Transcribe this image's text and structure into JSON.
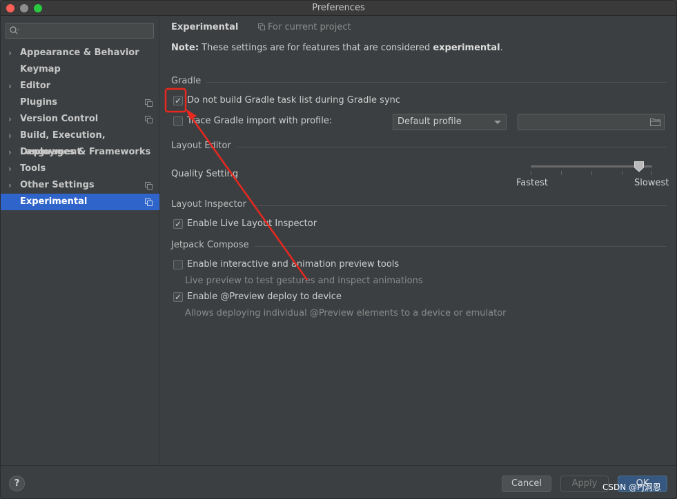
{
  "window": {
    "title": "Preferences"
  },
  "sidebar": {
    "search": {
      "placeholder": ""
    },
    "items": [
      {
        "label": "Appearance & Behavior",
        "expandable": true,
        "project_icon": false,
        "selected": false
      },
      {
        "label": "Keymap",
        "expandable": false,
        "project_icon": false,
        "selected": false
      },
      {
        "label": "Editor",
        "expandable": true,
        "project_icon": false,
        "selected": false
      },
      {
        "label": "Plugins",
        "expandable": false,
        "project_icon": true,
        "selected": false
      },
      {
        "label": "Version Control",
        "expandable": true,
        "project_icon": true,
        "selected": false
      },
      {
        "label": "Build, Execution, Deployment",
        "expandable": true,
        "project_icon": false,
        "selected": false
      },
      {
        "label": "Languages & Frameworks",
        "expandable": true,
        "project_icon": false,
        "selected": false
      },
      {
        "label": "Tools",
        "expandable": true,
        "project_icon": false,
        "selected": false
      },
      {
        "label": "Other Settings",
        "expandable": true,
        "project_icon": true,
        "selected": false
      },
      {
        "label": "Experimental",
        "expandable": false,
        "project_icon": true,
        "selected": true
      }
    ],
    "chevron": "›"
  },
  "content": {
    "title": "Experimental",
    "scope": "For current project",
    "note_prefix": "Note:",
    "note_text": " These settings are for features that are considered ",
    "note_bold": "experimental",
    "note_suffix": ".",
    "gradle": {
      "section": "Gradle",
      "no_task_list": {
        "label": "Do not build Gradle task list during Gradle sync",
        "checked": true
      },
      "trace_import": {
        "label": "Trace Gradle import with profile:",
        "checked": false
      },
      "profile_value": "Default profile",
      "profile_path": ""
    },
    "layout_editor": {
      "section": "Layout Editor",
      "quality_label": "Quality Setting",
      "min_label": "Fastest",
      "max_label": "Slowest",
      "quality_level": 0.9
    },
    "layout_inspector": {
      "section": "Layout Inspector",
      "live": {
        "label": "Enable Live Layout Inspector",
        "checked": true
      }
    },
    "compose": {
      "section": "Jetpack Compose",
      "interactive": {
        "label": "Enable interactive and animation preview tools",
        "checked": false,
        "hint": "Live preview to test gestures and inspect animations"
      },
      "deploy": {
        "label": "Enable @Preview deploy to device",
        "checked": true,
        "hint": "Allows deploying individual @Preview elements to a device or emulator"
      }
    }
  },
  "footer": {
    "help": "?",
    "cancel": "Cancel",
    "apply": "Apply",
    "ok": "OK"
  },
  "watermark": "CSDN @PJ洞恩",
  "check_glyph": "✓",
  "colors": {
    "selection": "#2f65ca",
    "annotation": "#e8281f",
    "ok_button": "#365880"
  }
}
